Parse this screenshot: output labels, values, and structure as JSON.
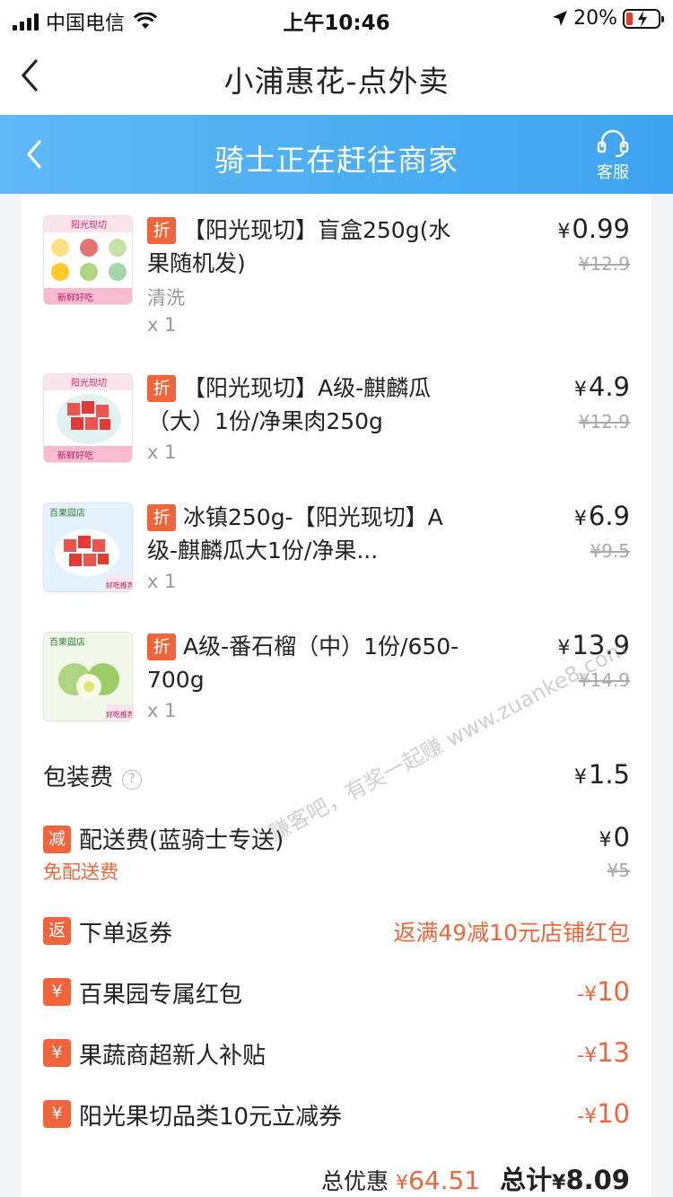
{
  "status_bar": {
    "carrier": "中国电信",
    "time": "上午10:46",
    "battery_percent": "20%",
    "battery_level": 0.2
  },
  "nav": {
    "title": "小浦惠花-点外卖"
  },
  "rider_bar": {
    "title": "骑士正在赶往商家",
    "service_label": "客服"
  },
  "items": [
    {
      "badge": "折",
      "name": "【阳光现切】盲盒250g(水果随机发)",
      "spec": "清洗",
      "qty": "x 1",
      "price": "0.99",
      "orig_price": "¥12.9",
      "yen": "¥"
    },
    {
      "badge": "折",
      "name": "【阳光现切】A级-麒麟瓜（大）1份/净果肉250g",
      "qty": "x 1",
      "price": "4.9",
      "orig_price": "¥12.9",
      "yen": "¥"
    },
    {
      "badge": "折",
      "name": "冰镇250g-【阳光现切】A级-麒麟瓜大1份/净果...",
      "qty": "x 1",
      "price": "6.9",
      "orig_price": "¥9.5",
      "yen": "¥"
    },
    {
      "badge": "折",
      "name": "A级-番石榴（中）1份/650-700g",
      "qty": "x 1",
      "price": "13.9",
      "orig_price": "¥14.9",
      "yen": "¥"
    }
  ],
  "thumb_labels": {
    "brand1": "阳光现切",
    "slogan1": "新鲜好吃",
    "store": "百果园店",
    "tag_recommend": "好吃推荐"
  },
  "fees": {
    "packing_label": "包装费",
    "packing_value": "1.5",
    "delivery_badge": "减",
    "delivery_label": "配送费(蓝骑士专送)",
    "delivery_note": "免配送费",
    "delivery_value": "0",
    "delivery_orig": "¥5"
  },
  "promos": {
    "rebate_badge": "返",
    "rebate_label": "下单返券",
    "rebate_value": "返满49减10元店铺红包",
    "coupons": [
      {
        "badge": "¥",
        "label": "百果园专属红包",
        "value": "10"
      },
      {
        "badge": "¥",
        "label": "果蔬商超新人补贴",
        "value": "13"
      },
      {
        "badge": "¥",
        "label": "阳光果切品类10元立减券",
        "value": "10"
      }
    ]
  },
  "summary": {
    "discount_label": "总优惠",
    "discount_value": "64.51",
    "total_label": "总计",
    "total_value": "8.09"
  },
  "watermark": "赚客吧，有奖一起赚 www.zuanke8.com",
  "colors": {
    "accent_blue": "#3ea4f0",
    "discount_red": "#f0653c"
  }
}
